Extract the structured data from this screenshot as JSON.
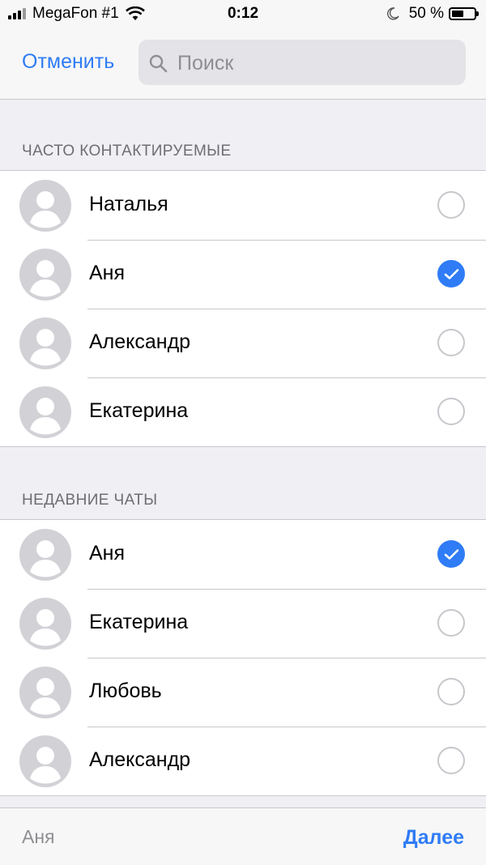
{
  "status_bar": {
    "carrier": "MegaFon #1",
    "time": "0:12",
    "battery": "50 %"
  },
  "header": {
    "cancel_label": "Отменить",
    "search_placeholder": "Поиск",
    "search_value": ""
  },
  "sections": [
    {
      "title": "ЧАСТО КОНТАКТИРУЕМЫЕ",
      "contacts": [
        {
          "name": "Наталья",
          "selected": false
        },
        {
          "name": "Аня",
          "selected": true
        },
        {
          "name": "Александр",
          "selected": false
        },
        {
          "name": "Екатерина",
          "selected": false
        }
      ]
    },
    {
      "title": "НЕДАВНИЕ ЧАТЫ",
      "contacts": [
        {
          "name": "Аня",
          "selected": true
        },
        {
          "name": "Екатерина",
          "selected": false
        },
        {
          "name": "Любовь",
          "selected": false
        },
        {
          "name": "Александр",
          "selected": false
        }
      ]
    }
  ],
  "bottom_bar": {
    "selected_summary": "Аня",
    "next_label": "Далее"
  },
  "colors": {
    "accent": "#2f7cf6",
    "background": "#efeff4",
    "separator": "#c8c7cc"
  }
}
